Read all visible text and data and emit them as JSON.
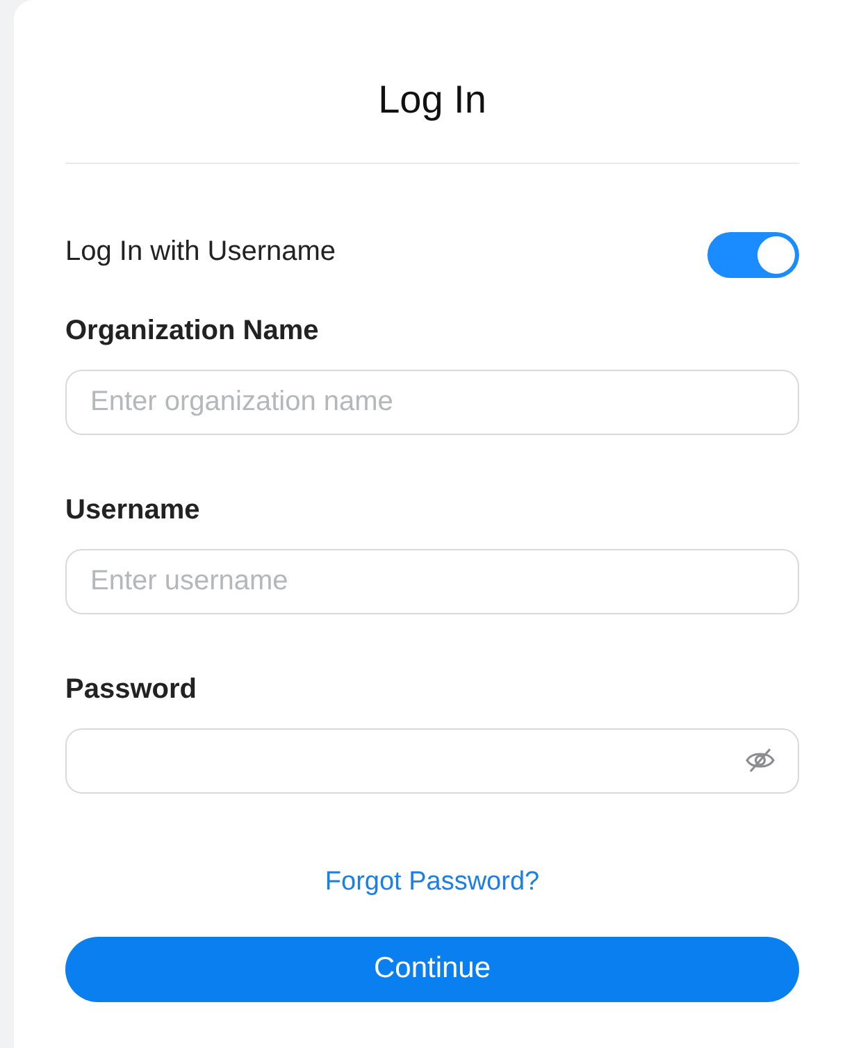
{
  "title": "Log In",
  "username_toggle": {
    "label": "Log In with Username",
    "on": true
  },
  "fields": [
    {
      "kind": "text",
      "label": "Organization Name",
      "placeholder": "Enter organization name"
    },
    {
      "kind": "text",
      "label": "Username",
      "placeholder": "Enter username"
    },
    {
      "kind": "password",
      "label": "Password"
    }
  ],
  "forgot_link": "Forgot Password?",
  "continue_button": "Continue"
}
